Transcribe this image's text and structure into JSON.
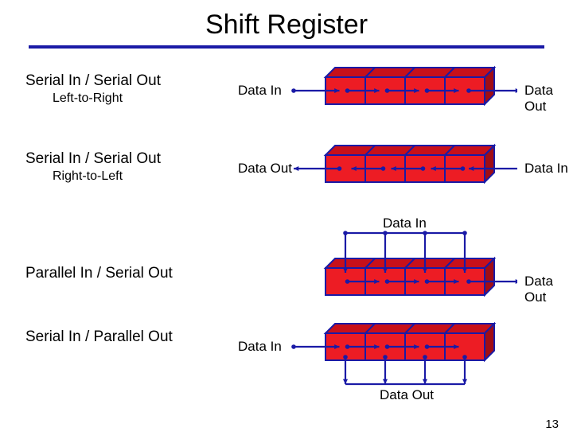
{
  "title": "Shift Register",
  "page_number": "13",
  "rows": [
    {
      "main": "Serial In / Serial Out",
      "sub": "Left-to-Right",
      "left_port": "Data In",
      "right_port": "Data Out",
      "direction": "ltr",
      "top_label": "",
      "bottom_label": ""
    },
    {
      "main": "Serial In / Serial Out",
      "sub": "Right-to-Left",
      "left_port": "Data Out",
      "right_port": "Data In",
      "direction": "rtl",
      "top_label": "",
      "bottom_label": ""
    },
    {
      "main": "Parallel In / Serial Out",
      "sub": "",
      "left_port": "",
      "right_port": "Data Out",
      "direction": "ltr",
      "top_label": "Data In",
      "bottom_label": ""
    },
    {
      "main": "Serial In / Parallel Out",
      "sub": "",
      "left_port": "Data In",
      "right_port": "",
      "direction": "ltr",
      "top_label": "",
      "bottom_label": "Data Out"
    }
  ],
  "chart_data": {
    "type": "diagram",
    "description": "Four 4-stage shift register configurations",
    "registers": [
      {
        "name": "Serial In / Serial Out (Left-to-Right)",
        "stages": 4,
        "flow": "left-to-right",
        "in": "serial-left",
        "out": "serial-right"
      },
      {
        "name": "Serial In / Serial Out (Right-to-Left)",
        "stages": 4,
        "flow": "right-to-left",
        "in": "serial-right",
        "out": "serial-left"
      },
      {
        "name": "Parallel In / Serial Out",
        "stages": 4,
        "flow": "left-to-right",
        "in": "parallel-top",
        "out": "serial-right"
      },
      {
        "name": "Serial In / Parallel Out",
        "stages": 4,
        "flow": "left-to-right",
        "in": "serial-left",
        "out": "parallel-bottom"
      }
    ]
  }
}
